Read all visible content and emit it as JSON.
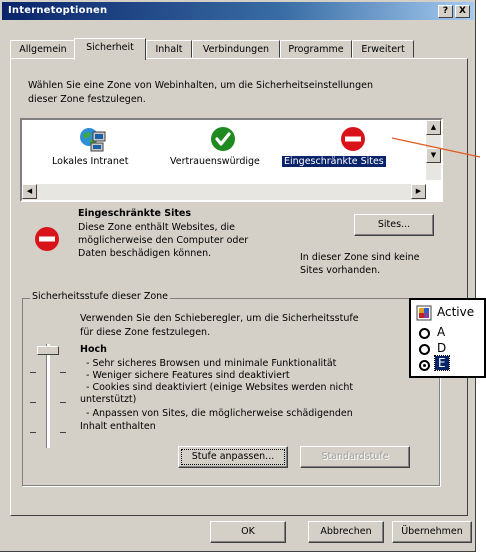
{
  "window": {
    "title": "Internetoptionen",
    "help_label": "?",
    "close_label": "X"
  },
  "tabs": [
    {
      "label": "Allgemein"
    },
    {
      "label": "Sicherheit"
    },
    {
      "label": "Inhalt"
    },
    {
      "label": "Verbindungen"
    },
    {
      "label": "Programme"
    },
    {
      "label": "Erweitert"
    }
  ],
  "security": {
    "intro": [
      "Wählen Sie eine Zone von Webinhalten, um die Sicherheitseinstellungen",
      "dieser Zone festzulegen."
    ],
    "zones": [
      {
        "label": "Lokales Intranet",
        "icon": "intranet-icon"
      },
      {
        "label": "Vertrauenswürdige",
        "icon": "trusted-check-icon"
      },
      {
        "label": "Eingeschränkte Sites",
        "icon": "restricted-icon"
      }
    ],
    "zone_title": "Eingeschränkte Sites",
    "zone_desc": [
      "Diese Zone enthält Websites, die",
      "möglicherweise den Computer oder",
      "Daten beschädigen können."
    ],
    "sites_button": "Sites...",
    "no_sites": [
      "In dieser Zone sind keine",
      "Sites vorhanden."
    ],
    "group_label": "Sicherheitsstufe dieser Zone",
    "slider_hint": [
      "Verwenden Sie den Schieberegler, um die Sicherheitsstufe",
      "für diese Zone festzulegen."
    ],
    "level_name": "Hoch",
    "level_details": [
      "- Sehr sicheres Browsen und minimale Funktionalität",
      "- Weniger sichere Features sind deaktiviert",
      "- Cookies sind deaktiviert (einige Websites werden nicht",
      "unterstützt)",
      "- Anpassen von Sites, die möglicherweise schädigenden",
      "Inhalt enthalten"
    ],
    "custom_level_button": "Stufe anpassen...",
    "default_level_button": "Standardstufe"
  },
  "footer": {
    "ok_label": "OK",
    "cancel_label": "Abbrechen",
    "apply_label": "Übernehmen"
  },
  "popup": {
    "title": "Active",
    "options": [
      {
        "label": "A",
        "selected": false
      },
      {
        "label": "D",
        "selected": false
      },
      {
        "label": "E",
        "selected": true
      }
    ]
  },
  "colors": {
    "title_bar": "#0a246a",
    "dialog_face": "#d4d0c8",
    "selection": "#0a246a",
    "annotation_line": "#e05a20",
    "restricted_red": "#d8141a",
    "trusted_green": "#1f8a1f"
  }
}
